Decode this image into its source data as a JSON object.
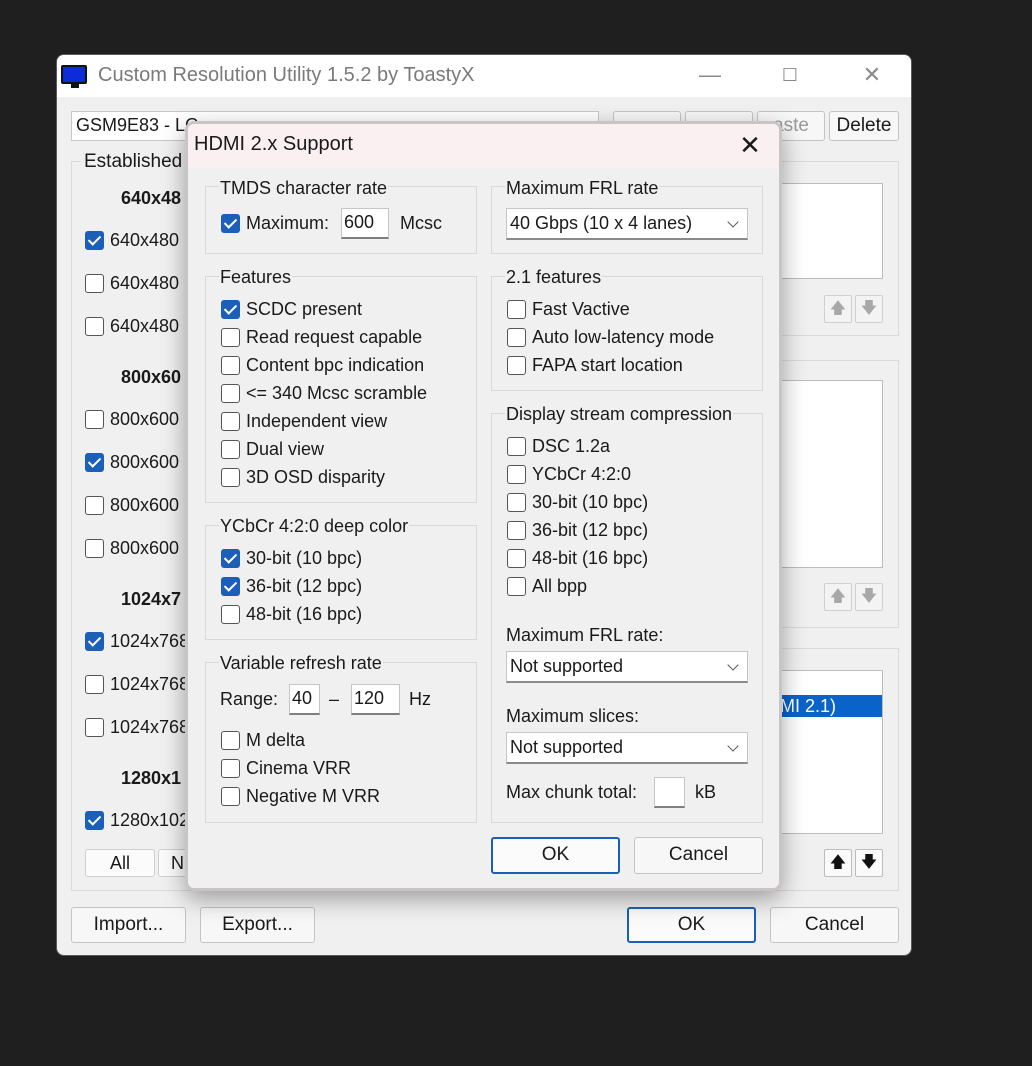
{
  "main_window": {
    "title": "Custom Resolution Utility 1.5.2 by ToastyX",
    "caption": {
      "minimize": "—",
      "maximize": "☐",
      "close": "✕"
    },
    "monitor_combo": "GSM9E83 - LG",
    "toolbar": {
      "paste_label": "aste",
      "delete_label": "Delete"
    },
    "established": {
      "label": "Established",
      "sections": [
        {
          "heading": "640x48",
          "items": [
            {
              "label": "640x480",
              "checked": true
            },
            {
              "label": "640x480",
              "checked": false
            },
            {
              "label": "640x480",
              "checked": false
            }
          ]
        },
        {
          "heading": "800x60",
          "items": [
            {
              "label": "800x600",
              "checked": false
            },
            {
              "label": "800x600",
              "checked": true
            },
            {
              "label": "800x600",
              "checked": false
            },
            {
              "label": "800x600",
              "checked": false
            }
          ]
        },
        {
          "heading": "1024x7",
          "items": [
            {
              "label": "1024x768",
              "checked": true
            },
            {
              "label": "1024x768",
              "checked": false
            },
            {
              "label": "1024x768",
              "checked": false
            }
          ]
        },
        {
          "heading": "1280x1",
          "items": [
            {
              "label": "1280x102",
              "checked": true
            }
          ]
        }
      ],
      "all_label": "All",
      "none_label": "N"
    },
    "selected_extension_item": "MI 2.1)",
    "import_label": "Import...",
    "export_label": "Export...",
    "ok_label": "OK",
    "cancel_label": "Cancel"
  },
  "dialog": {
    "title": "HDMI 2.x Support",
    "close_glyph": "✕",
    "tmds": {
      "label": "TMDS character rate",
      "maximum_label": "Maximum:",
      "maximum_checked": true,
      "value": "600",
      "unit": "Mcsc"
    },
    "features": {
      "label": "Features",
      "items": [
        {
          "label": "SCDC present",
          "checked": true
        },
        {
          "label": "Read request capable",
          "checked": false
        },
        {
          "label": "Content bpc indication",
          "checked": false
        },
        {
          "label": "<= 340 Mcsc scramble",
          "checked": false
        },
        {
          "label": "Independent view",
          "checked": false
        },
        {
          "label": "Dual view",
          "checked": false
        },
        {
          "label": "3D OSD disparity",
          "checked": false
        }
      ]
    },
    "ycbcr420": {
      "label": "YCbCr 4:2:0 deep color",
      "items": [
        {
          "label": "30-bit (10 bpc)",
          "checked": true
        },
        {
          "label": "36-bit (12 bpc)",
          "checked": true
        },
        {
          "label": "48-bit (16 bpc)",
          "checked": false
        }
      ]
    },
    "vrr": {
      "label": "Variable refresh rate",
      "range_label": "Range:",
      "min": "40",
      "dash": "–",
      "max": "120",
      "unit": "Hz",
      "items": [
        {
          "label": "M delta",
          "checked": false
        },
        {
          "label": "Cinema VRR",
          "checked": false
        },
        {
          "label": "Negative M VRR",
          "checked": false
        }
      ]
    },
    "frl": {
      "label": "Maximum FRL rate",
      "value": "40 Gbps (10 x 4 lanes)"
    },
    "features21": {
      "label": "2.1 features",
      "items": [
        {
          "label": "Fast Vactive",
          "checked": false
        },
        {
          "label": "Auto low-latency mode",
          "checked": false
        },
        {
          "label": "FAPA start location",
          "checked": false
        }
      ]
    },
    "dsc": {
      "label": "Display stream compression",
      "items": [
        {
          "label": "DSC 1.2a",
          "checked": false
        },
        {
          "label": "YCbCr 4:2:0",
          "checked": false
        },
        {
          "label": "30-bit (10 bpc)",
          "checked": false
        },
        {
          "label": "36-bit (12 bpc)",
          "checked": false
        },
        {
          "label": "48-bit (16 bpc)",
          "checked": false
        },
        {
          "label": "All bpp",
          "checked": false
        }
      ],
      "frl_label": "Maximum FRL rate:",
      "frl_value": "Not supported",
      "slices_label": "Maximum slices:",
      "slices_value": "Not supported",
      "chunk_label": "Max chunk total:",
      "chunk_value": "",
      "chunk_unit": "kB"
    },
    "ok_label": "OK",
    "cancel_label": "Cancel"
  }
}
